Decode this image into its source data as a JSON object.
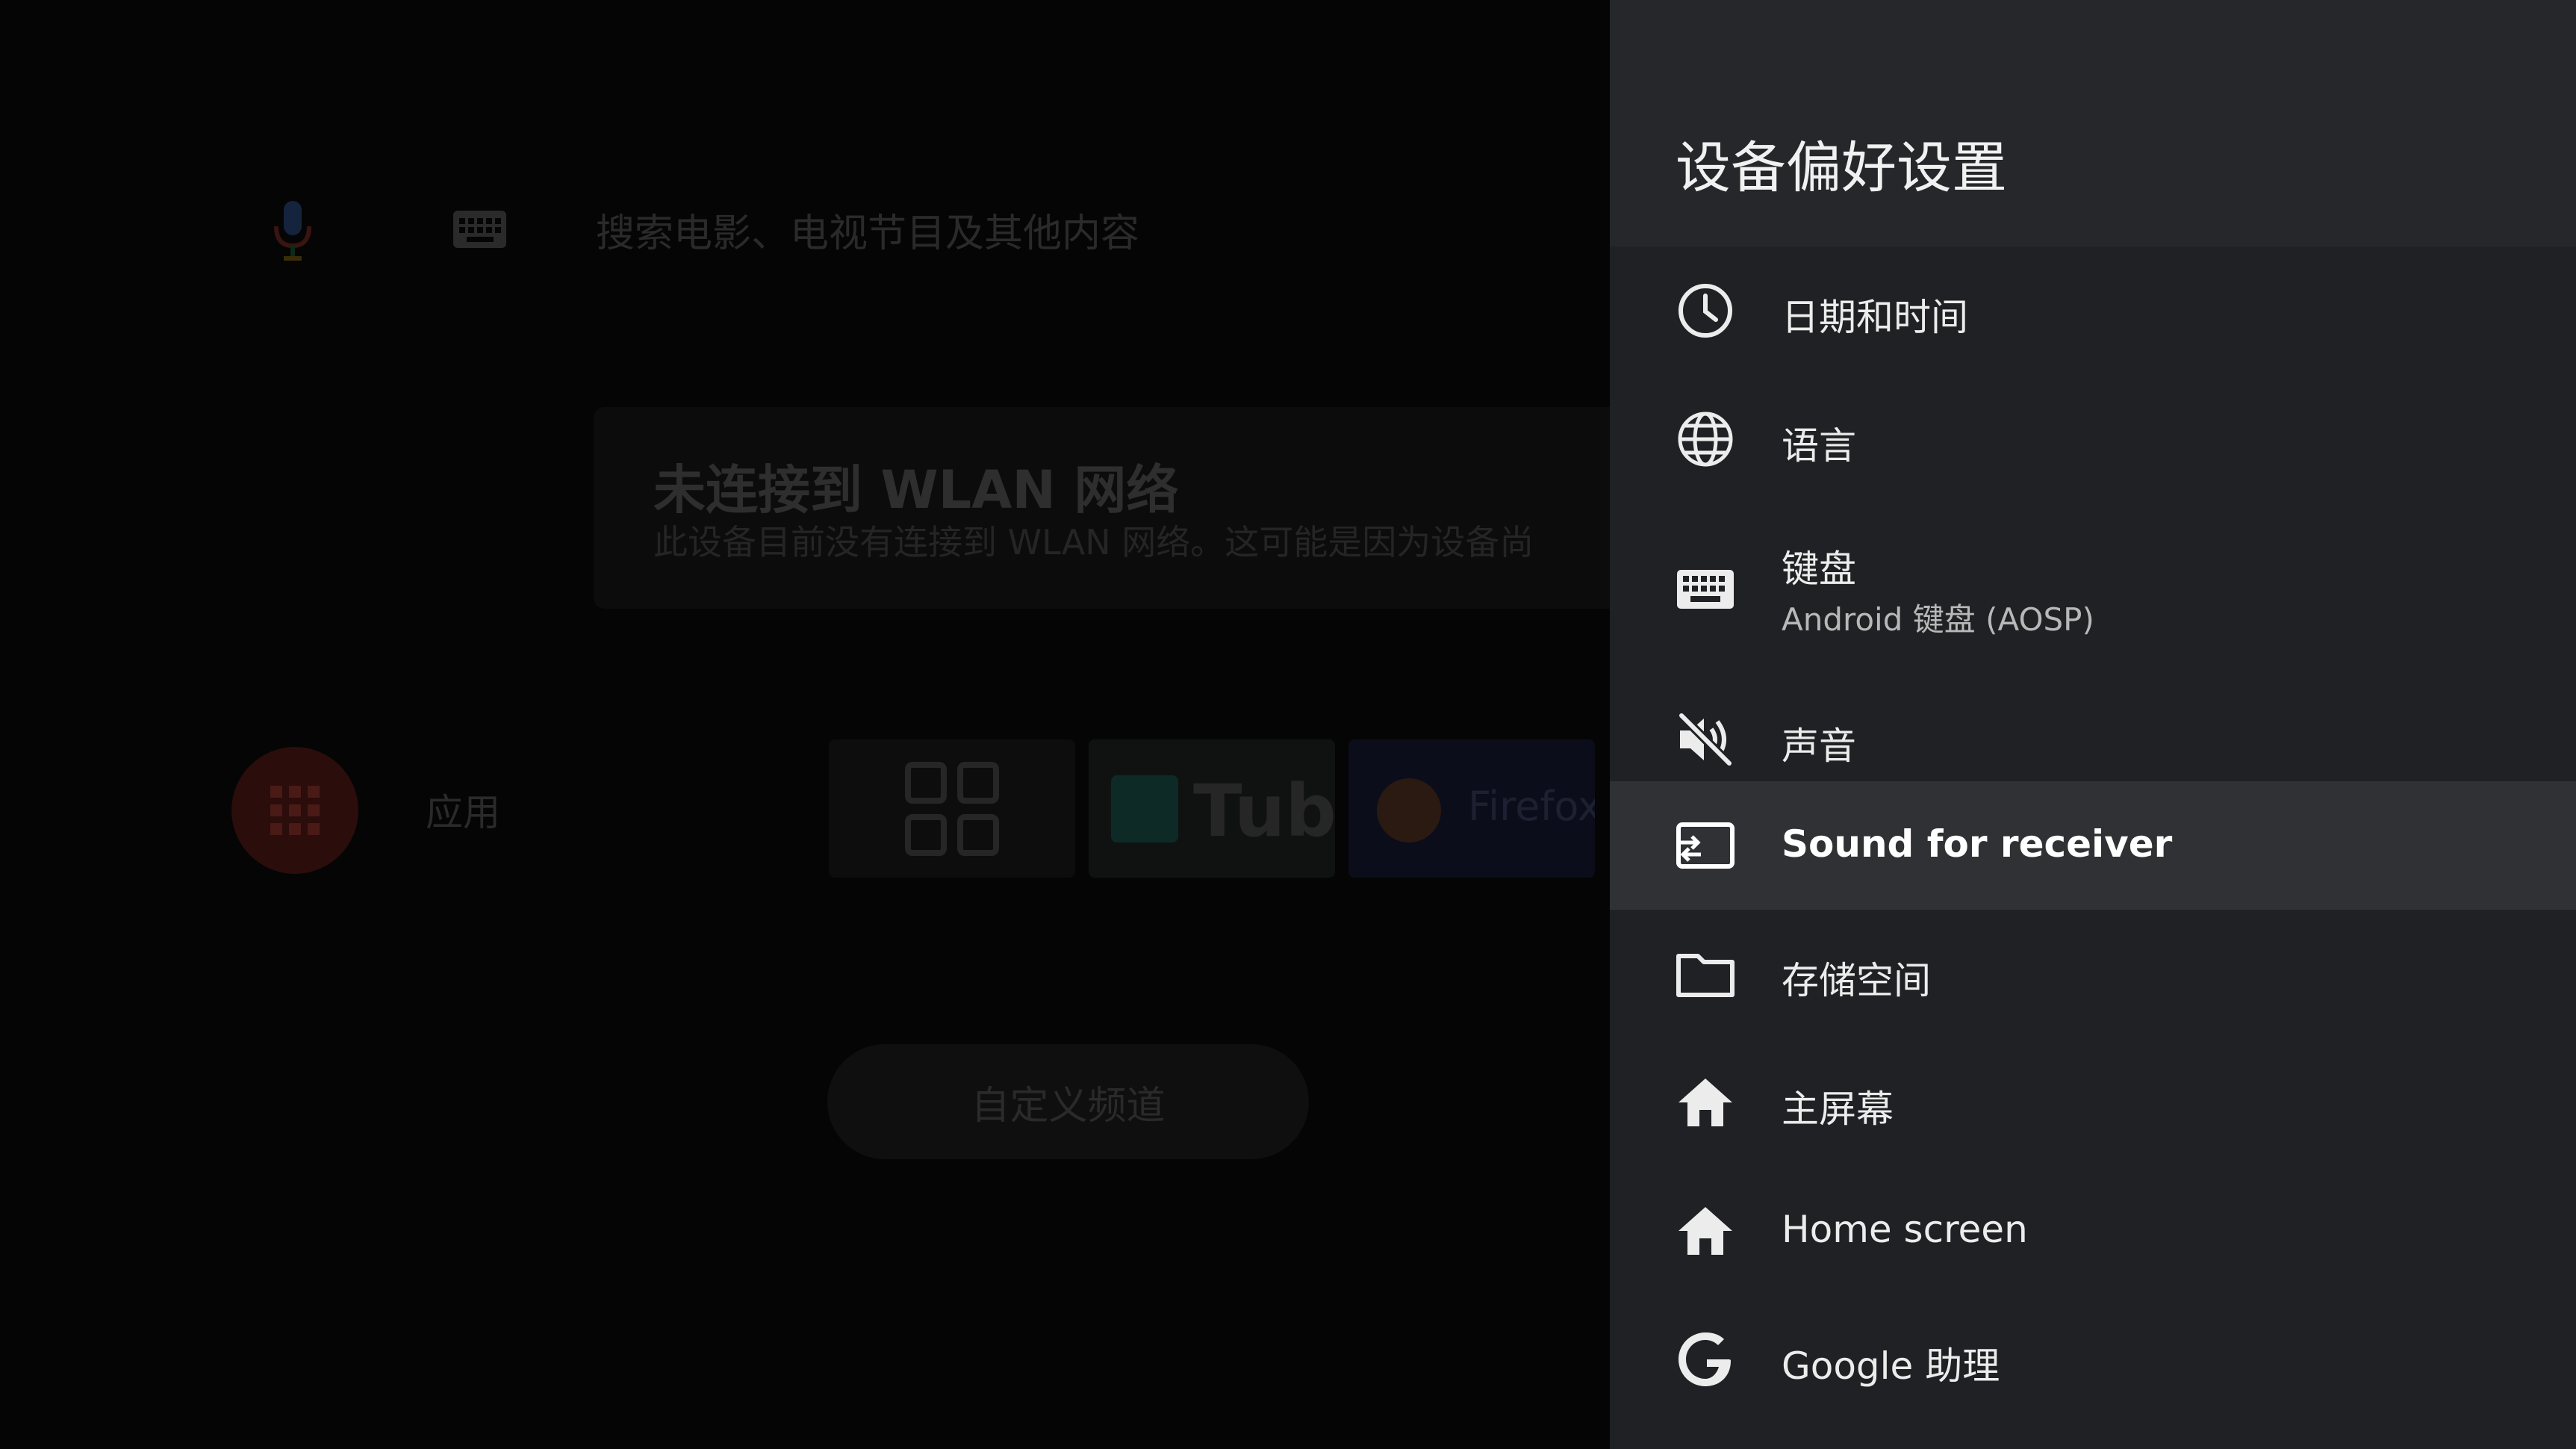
{
  "background": {
    "search": {
      "placeholder_text": "搜索电影、电视节目及其他内容"
    },
    "wifi_card": {
      "title": "未连接到 WLAN 网络",
      "subtitle": "此设备目前没有连接到 WLAN 网络。这可能是因为设备尚"
    },
    "apps": {
      "label": "应用"
    },
    "tiles": [
      {
        "name": "apps-grid-tile",
        "text": ""
      },
      {
        "name": "youtube-tile",
        "text": "Tube"
      },
      {
        "name": "firefox-tile",
        "text": "Firefox"
      }
    ],
    "customize_channels_label": "自定义频道"
  },
  "panel": {
    "title": "设备偏好设置",
    "items": [
      {
        "label": "日期和时间",
        "icon": "clock-icon"
      },
      {
        "label": "语言",
        "icon": "globe-icon"
      },
      {
        "label": "键盘",
        "sublabel": "Android 键盘 (AOSP)",
        "icon": "keyboard-icon"
      },
      {
        "label": "声音",
        "icon": "volume-off-icon"
      },
      {
        "label": "Sound for receiver",
        "icon": "cast-icon",
        "selected": true
      },
      {
        "label": "存储空间",
        "icon": "folder-icon"
      },
      {
        "label": "主屏幕",
        "icon": "home-icon"
      },
      {
        "label": "Home screen",
        "icon": "home-icon"
      },
      {
        "label": "Google 助理",
        "icon": "google-icon"
      }
    ]
  },
  "colors": {
    "panel_bg": "#202124",
    "panel_header_bg": "#26272a",
    "selected_bg": "#303134",
    "text_primary": "#ececec",
    "text_secondary": "#b8b8b8"
  }
}
